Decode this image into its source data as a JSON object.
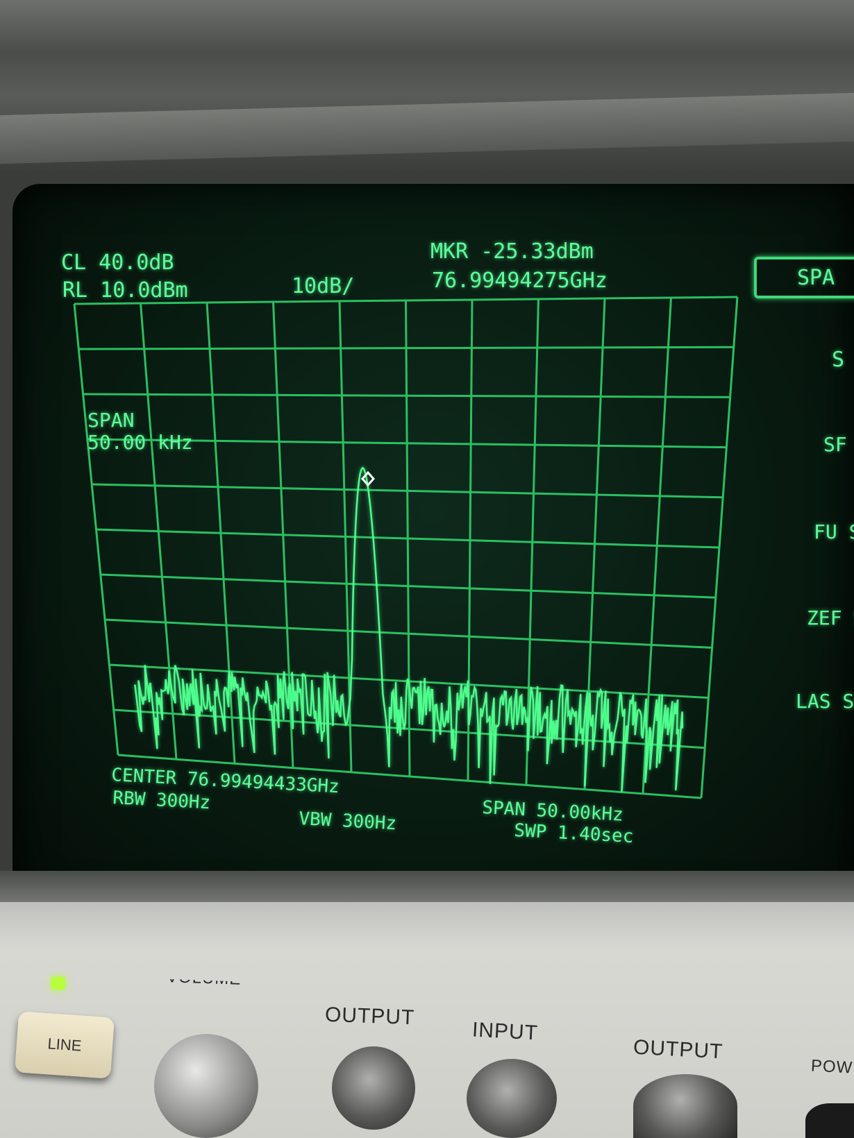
{
  "display": {
    "top_left": {
      "cl": "CL 40.0dB",
      "rl": "RL 10.0dBm"
    },
    "scale": "10dB/",
    "marker": {
      "level": "MKR -25.33dBm",
      "frequency": "76.99494275GHz"
    },
    "span_annotation": {
      "label": "SPAN",
      "value": "50.00 kHz"
    },
    "bottom": {
      "center": "CENTER 76.99494433GHz",
      "rbw": "RBW 300Hz",
      "vbw": "VBW 300Hz",
      "span": "SPAN 50.00kHz",
      "swp": "SWP 1.40sec"
    },
    "softkeys": [
      "SPA",
      "S",
      "SF ZO",
      "FU SP",
      "ZEF SPA",
      "LAS SPAN"
    ]
  },
  "front_panel": {
    "line_button": "LINE",
    "labels": {
      "volume": "VOLUME",
      "output1": "OUTPUT",
      "input": "INPUT",
      "output2": "OUTPUT",
      "power": "POW"
    }
  },
  "colors": {
    "trace": "#4dff8c",
    "graticule": "#2fd16a",
    "screen": "#081a10"
  },
  "chart_data": {
    "type": "line",
    "x_center_hz": 76994944330,
    "span_hz": 50000,
    "ylabel": "",
    "ref_level_dbm": 10,
    "db_per_div": 10,
    "ylim": [
      -90,
      10
    ],
    "peak": {
      "level_dbm": -25.33,
      "frequency": "76.99494275GHz"
    },
    "noise_floor_dbm": -76
  }
}
